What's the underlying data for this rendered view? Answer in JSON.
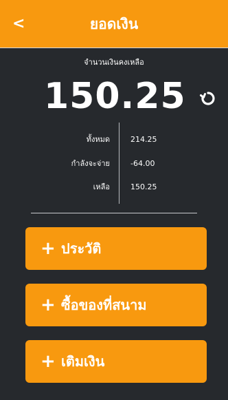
{
  "header": {
    "back_label": "<",
    "title": "ยอดเงิน"
  },
  "balance": {
    "caption": "จำนวนเงินคงเหลือ",
    "amount": "150.25",
    "refresh_icon": "refresh-icon"
  },
  "details": [
    {
      "label": "ทั้งหมด",
      "value": "214.25"
    },
    {
      "label": "กำลังจะจ่าย",
      "value": "-64.00"
    },
    {
      "label": "เหลือ",
      "value": "150.25"
    }
  ],
  "actions": [
    {
      "icon": "+",
      "label": "ประวัติ"
    },
    {
      "icon": "+",
      "label": "ซื้อของที่สนาม"
    },
    {
      "icon": "+",
      "label": "เติมเงิน"
    }
  ],
  "colors": {
    "accent": "#f8990f",
    "background": "#26292d",
    "text": "#ffffff"
  }
}
